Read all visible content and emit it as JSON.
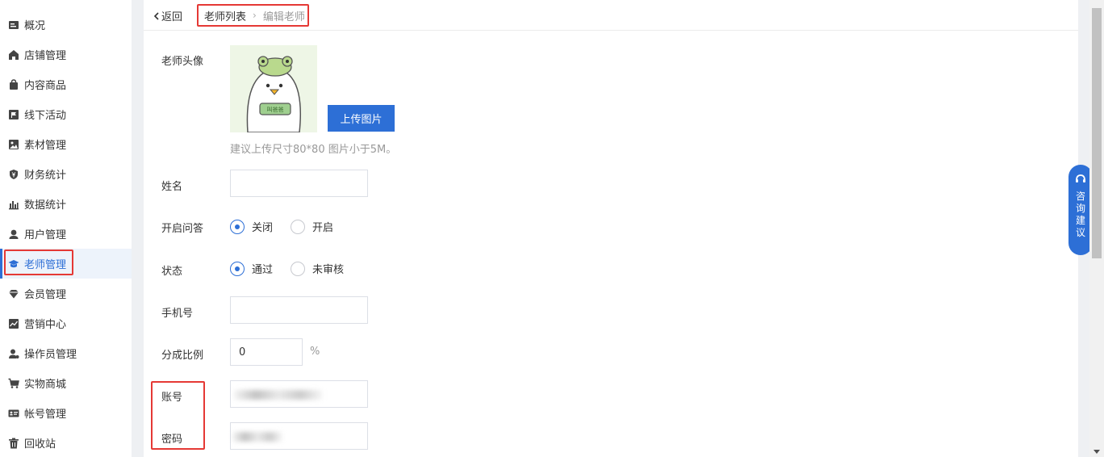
{
  "sidebar": {
    "items": [
      {
        "label": "概况",
        "icon": "overview-icon"
      },
      {
        "label": "店铺管理",
        "icon": "store-icon"
      },
      {
        "label": "内容商品",
        "icon": "bag-icon"
      },
      {
        "label": "线下活动",
        "icon": "flag-icon"
      },
      {
        "label": "素材管理",
        "icon": "image-icon"
      },
      {
        "label": "财务统计",
        "icon": "yen-shield-icon"
      },
      {
        "label": "数据统计",
        "icon": "bar-chart-icon"
      },
      {
        "label": "用户管理",
        "icon": "user-icon"
      },
      {
        "label": "老师管理",
        "icon": "graduation-cap-icon",
        "active": true
      },
      {
        "label": "会员管理",
        "icon": "diamond-icon"
      },
      {
        "label": "营销中心",
        "icon": "trend-icon"
      },
      {
        "label": "操作员管理",
        "icon": "operator-icon"
      },
      {
        "label": "实物商城",
        "icon": "cart-icon"
      },
      {
        "label": "帐号管理",
        "icon": "id-card-icon"
      },
      {
        "label": "回收站",
        "icon": "trash-icon"
      }
    ]
  },
  "header": {
    "back_label": "返回",
    "breadcrumb_list": "老师列表",
    "breadcrumb_sep": "›",
    "breadcrumb_current": "编辑老师"
  },
  "form": {
    "avatar_label": "老师头像",
    "avatar_badge": "叫爸爸",
    "upload_label": "上传图片",
    "upload_hint": "建议上传尺寸80*80 图片小于5M。",
    "name_label": "姓名",
    "name_value": "",
    "qa_label": "开启问答",
    "qa_options": [
      "关闭",
      "开启"
    ],
    "qa_selected": "关闭",
    "status_label": "状态",
    "status_options": [
      "通过",
      "未审核"
    ],
    "status_selected": "通过",
    "phone_label": "手机号",
    "phone_value": "",
    "ratio_label": "分成比例",
    "ratio_value": "0",
    "ratio_unit": "%",
    "account_label": "账号",
    "password_label": "密码"
  },
  "consult": {
    "label": "咨询建议"
  },
  "colors": {
    "accent": "#2d6fd6",
    "highlight": "#e53935"
  }
}
